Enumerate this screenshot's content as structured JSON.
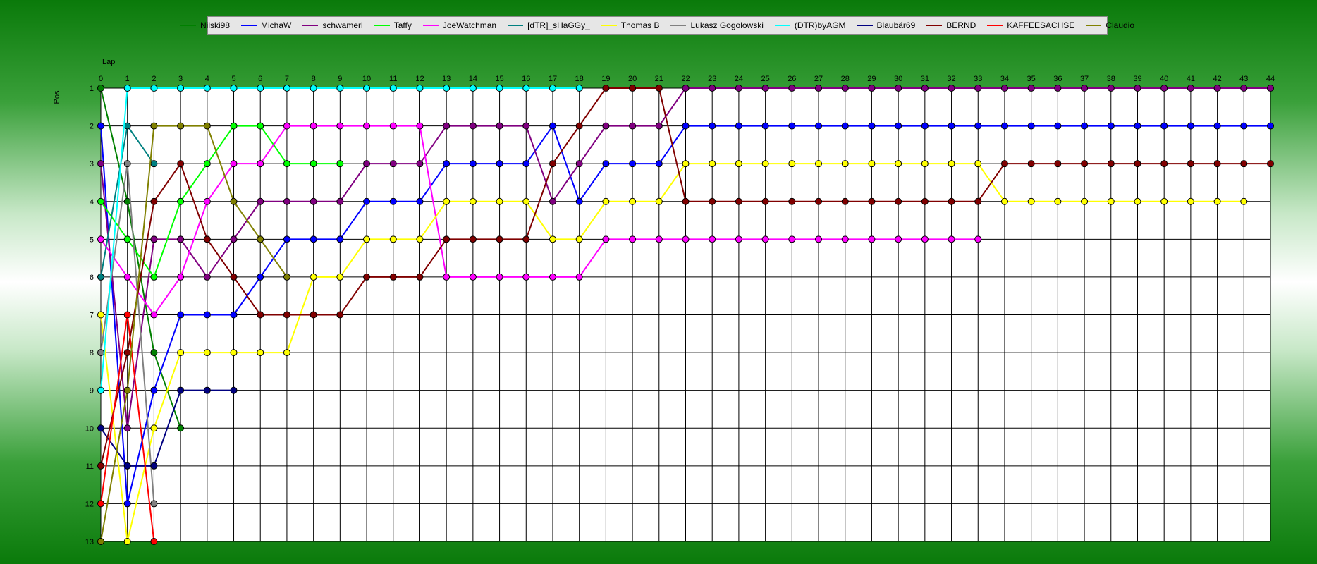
{
  "chart_data": {
    "type": "line",
    "xlabel": "Lap",
    "ylabel": "Pos",
    "x": [
      0,
      1,
      2,
      3,
      4,
      5,
      6,
      7,
      8,
      9,
      10,
      11,
      12,
      13,
      14,
      15,
      16,
      17,
      18,
      19,
      20,
      21,
      22,
      23,
      24,
      25,
      26,
      27,
      28,
      29,
      30,
      31,
      32,
      33,
      34,
      35,
      36,
      37,
      38,
      39,
      40,
      41,
      42,
      43,
      44
    ],
    "y_ticks": [
      1,
      2,
      3,
      4,
      5,
      6,
      7,
      8,
      9,
      10,
      11,
      12,
      13
    ],
    "xlim": [
      0,
      44
    ],
    "ylim": [
      1,
      13
    ],
    "y_inverted": true,
    "grid": true,
    "legend_position": "top",
    "series": [
      {
        "name": "Nilski98",
        "color": "#008000",
        "values": [
          1,
          4,
          8,
          10
        ]
      },
      {
        "name": "MichaW",
        "color": "#0000ff",
        "values": [
          2,
          12,
          9,
          7,
          7,
          7,
          6,
          5,
          5,
          5,
          4,
          4,
          4,
          3,
          3,
          3,
          3,
          2,
          4,
          3,
          3,
          3,
          2,
          2,
          2,
          2,
          2,
          2,
          2,
          2,
          2,
          2,
          2,
          2,
          2,
          2,
          2,
          2,
          2,
          2,
          2,
          2,
          2,
          2,
          2
        ]
      },
      {
        "name": "schwamerl",
        "color": "#800080",
        "values": [
          3,
          10,
          5,
          5,
          6,
          5,
          4,
          4,
          4,
          4,
          3,
          3,
          3,
          2,
          2,
          2,
          2,
          4,
          3,
          2,
          2,
          2,
          1,
          1,
          1,
          1,
          1,
          1,
          1,
          1,
          1,
          1,
          1,
          1,
          1,
          1,
          1,
          1,
          1,
          1,
          1,
          1,
          1,
          1,
          1
        ]
      },
      {
        "name": "Taffy",
        "color": "#00ff00",
        "values": [
          4,
          5,
          6,
          4,
          3,
          2,
          2,
          3,
          3,
          3
        ]
      },
      {
        "name": "JoeWatchman",
        "color": "#ff00ff",
        "values": [
          5,
          6,
          7,
          6,
          4,
          3,
          3,
          2,
          2,
          2,
          2,
          2,
          2,
          6,
          6,
          6,
          6,
          6,
          6,
          5,
          5,
          5,
          5,
          5,
          5,
          5,
          5,
          5,
          5,
          5,
          5,
          5,
          5,
          5
        ]
      },
      {
        "name": "[dTR]_sHaGGy_",
        "color": "#008080",
        "values": [
          6,
          2,
          3
        ]
      },
      {
        "name": "Thomas B",
        "color": "#ffff00",
        "values": [
          7,
          13,
          10,
          8,
          8,
          8,
          8,
          8,
          6,
          6,
          5,
          5,
          5,
          4,
          4,
          4,
          4,
          5,
          5,
          4,
          4,
          4,
          3,
          3,
          3,
          3,
          3,
          3,
          3,
          3,
          3,
          3,
          3,
          3,
          4,
          4,
          4,
          4,
          4,
          4,
          4,
          4,
          4,
          4
        ]
      },
      {
        "name": "Lukasz Gogolowski",
        "color": "#808080",
        "values": [
          8,
          3,
          12
        ]
      },
      {
        "name": "(DTR)byAGM",
        "color": "#00ffff",
        "values": [
          9,
          1,
          1,
          1,
          1,
          1,
          1,
          1,
          1,
          1,
          1,
          1,
          1,
          1,
          1,
          1,
          1,
          1,
          1
        ]
      },
      {
        "name": "Blaubär69",
        "color": "#000080",
        "values": [
          10,
          11,
          11,
          9,
          9,
          9
        ]
      },
      {
        "name": "BERND",
        "color": "#800000",
        "values": [
          11,
          8,
          4,
          3,
          5,
          6,
          7,
          7,
          7,
          7,
          6,
          6,
          6,
          5,
          5,
          5,
          5,
          3,
          2,
          1,
          1,
          1,
          4,
          4,
          4,
          4,
          4,
          4,
          4,
          4,
          4,
          4,
          4,
          4,
          3,
          3,
          3,
          3,
          3,
          3,
          3,
          3,
          3,
          3,
          3
        ]
      },
      {
        "name": "KAFFEESACHSE",
        "color": "#ff0000",
        "values": [
          12,
          7,
          13
        ]
      },
      {
        "name": "Claudio",
        "color": "#808000",
        "values": [
          13,
          9,
          2,
          2,
          2,
          4,
          5,
          6
        ]
      }
    ]
  }
}
